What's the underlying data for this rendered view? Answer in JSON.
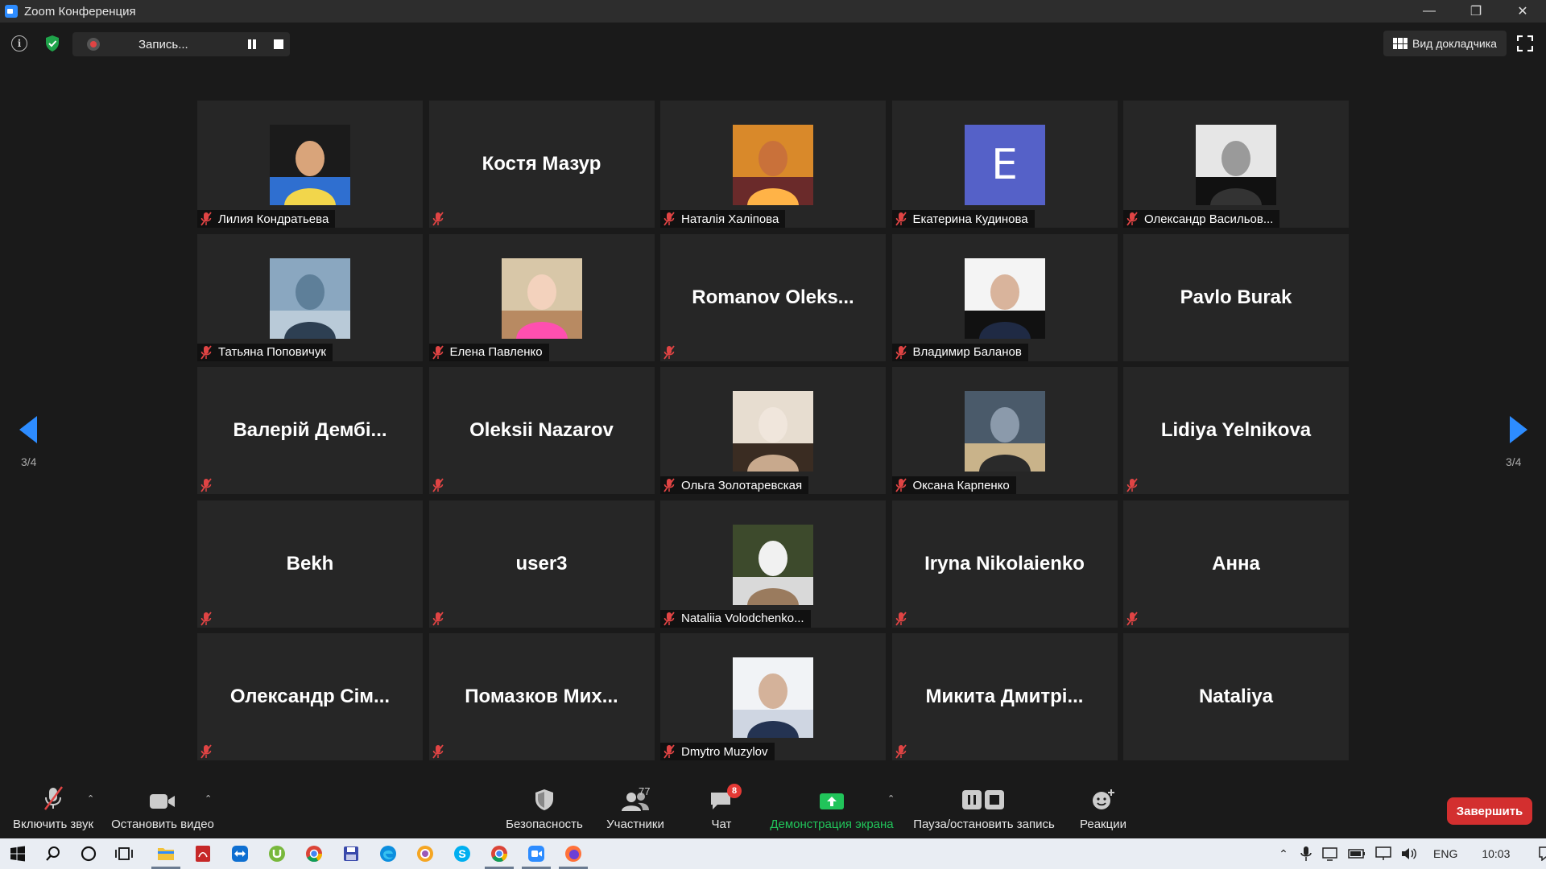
{
  "window": {
    "title": "Zoom Конференция",
    "min_icon": "minimize-icon",
    "max_icon": "restore-icon",
    "close_icon": "close-icon"
  },
  "topbar": {
    "recording_label": "Запись...",
    "speaker_view_label": "Вид докладчика"
  },
  "pagination": {
    "left": "3/4",
    "right": "3/4"
  },
  "colors": {
    "accent": "#2d8cff",
    "tile_bg": "#262626",
    "mute_red": "#e04444",
    "end_red": "#d32f2f",
    "share_green": "#21c45a"
  },
  "participants": [
    {
      "name": "Лилия Кондратьева",
      "display": "photo"
    },
    {
      "name": "Костя Мазур",
      "display": "name"
    },
    {
      "name": "Наталія Халіпова",
      "display": "photo"
    },
    {
      "name": "Екатерина Кудинова",
      "display": "letter",
      "letter": "E"
    },
    {
      "name": "Олександр Васильов...",
      "display": "photo"
    },
    {
      "name": "Татьяна Поповичук",
      "display": "photo"
    },
    {
      "name": "Елена Павленко",
      "display": "photo"
    },
    {
      "name": "Romanov  Oleks...",
      "display": "name"
    },
    {
      "name": "Владимир Баланов",
      "display": "photo"
    },
    {
      "name": "Pavlo Burak",
      "display": "name"
    },
    {
      "name": "Валерій Дембі...",
      "display": "name"
    },
    {
      "name": "Oleksii Nazarov",
      "display": "name"
    },
    {
      "name": "Ольга Золотаревская",
      "display": "photo"
    },
    {
      "name": "Оксана Карпенко",
      "display": "photo"
    },
    {
      "name": "Lidiya Yelnikova",
      "display": "name"
    },
    {
      "name": "Bekh",
      "display": "name"
    },
    {
      "name": "user3",
      "display": "name"
    },
    {
      "name": "Nataliia Volodchenko...",
      "display": "photo"
    },
    {
      "name": "Iryna Nikolaienko",
      "display": "name"
    },
    {
      "name": "Анна",
      "display": "name"
    },
    {
      "name": "Олександр  Сім...",
      "display": "name"
    },
    {
      "name": "Помазков  Мих...",
      "display": "name"
    },
    {
      "name": "Dmytro Muzylov",
      "display": "photo"
    },
    {
      "name": "Микита  Дмитрі...",
      "display": "name"
    },
    {
      "name": "Nataliya",
      "display": "name"
    }
  ],
  "toolbar": {
    "unmute": "Включить звук",
    "stop_video": "Остановить видео",
    "security": "Безопасность",
    "participants": "Участники",
    "participants_count": "77",
    "chat": "Чат",
    "chat_badge": "8",
    "share": "Демонстрация экрана",
    "pause_rec": "Пауза/остановить запись",
    "reactions": "Реакции",
    "end": "Завершить"
  },
  "taskbar": {
    "lang": "ENG",
    "time": "10:03"
  }
}
